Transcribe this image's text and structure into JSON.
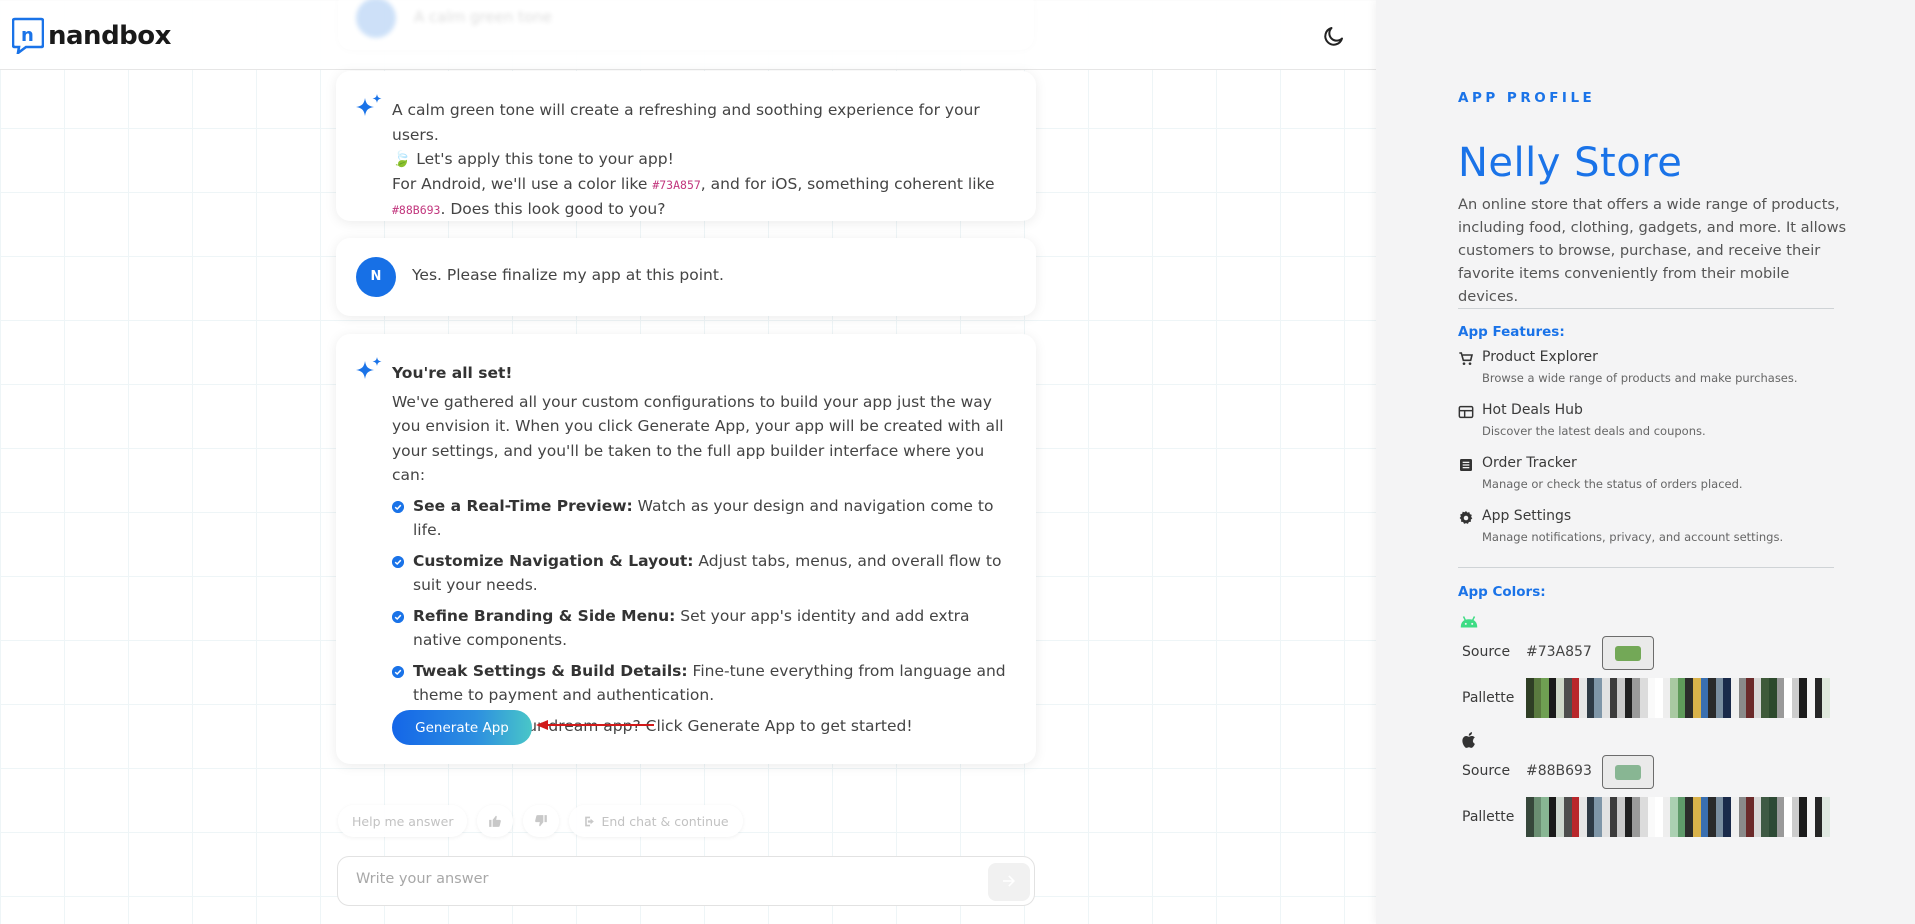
{
  "header": {
    "logo_text": "nandbox",
    "logo_mark_letter": "n",
    "theme_icon": "moon-icon"
  },
  "faded_card": {
    "text": "A calm green tone"
  },
  "assistant_message_1": {
    "line1": "A calm green tone will create a refreshing and soothing experience for your users.",
    "line2_emoji": "🍃",
    "line2": "Let's apply this tone to your app!",
    "line3_pre": "For Android, we'll use a color like ",
    "android_code": "#73A857",
    "line3_post": ", and for iOS, something coherent like",
    "ios_code": "#88B693",
    "line4_post": ". Does this look good to you?"
  },
  "user_message": {
    "avatar_letter": "N",
    "text": "Yes. Please finalize my app at this point."
  },
  "assistant_message_2": {
    "title": "You're all set!",
    "intro": "We've gathered all your custom configurations to build your app just the way you envision it. When you click Generate App, your app will be created with all your settings, and you'll be taken to the full app builder interface where you can:",
    "bullets": [
      {
        "bold": "See a Real-Time Preview:",
        "text": " Watch as your design and navigation come to life."
      },
      {
        "bold": "Customize Navigation & Layout:",
        "text": " Adjust tabs, menus, and overall flow to suit your needs."
      },
      {
        "bold": "Refine Branding & Side Menu:",
        "text": " Set your app's identity and add extra native components."
      },
      {
        "bold": "Tweak Settings & Build Details:",
        "text": " Fine-tune everything from language and theme to payment and authentication."
      }
    ],
    "outro": "Ready to build your dream app? Click Generate App to get started!",
    "button_label": "Generate App"
  },
  "chips": {
    "help_label": "Help me answer",
    "like_icon": "thumbs-up-icon",
    "dislike_icon": "thumbs-down-icon",
    "end_label": "End chat & continue"
  },
  "composer": {
    "placeholder": "Write your answer",
    "send_icon": "arrow-right-icon"
  },
  "profile": {
    "eyebrow": "APP PROFILE",
    "name": "Nelly Store",
    "description": "An online store that offers a wide range of products, including food, clothing, gadgets, and more. It allows customers to browse, purchase, and receive their favorite items conveniently from their mobile devices.",
    "features_title": "App Features:",
    "features": [
      {
        "icon": "cart-icon",
        "title": "Product Explorer",
        "desc": "Browse a wide range of products and make purchases."
      },
      {
        "icon": "deals-card-icon",
        "title": "Hot Deals Hub",
        "desc": "Discover the latest deals and coupons."
      },
      {
        "icon": "list-document-icon",
        "title": "Order Tracker",
        "desc": "Manage or check the status of orders placed."
      },
      {
        "icon": "gear-icon",
        "title": "App Settings",
        "desc": "Manage notifications, privacy, and account settings."
      }
    ],
    "colors_title": "App Colors:",
    "android": {
      "icon": "android-icon",
      "source_label": "Source",
      "source_hex": "#73A857",
      "swatch_color": "#73A857",
      "palette_label": "Pallette",
      "palette": [
        "#2f3e25",
        "#5a7a3f",
        "#6f9f52",
        "#1a1a1a",
        "#cfd8c8",
        "#4d4d4d",
        "#b8272b",
        "#e6e6e6",
        "#2e3a45",
        "#7f96a8",
        "#e2e2e2",
        "#3b3b3b",
        "#c9c9c9",
        "#1f1f1f",
        "#9a9a9a",
        "#dcdcdc",
        "#fafafa",
        "#ffffff",
        "#eeeeee",
        "#a9c9a2",
        "#5f9a5a",
        "#2b2b2b",
        "#d9b24a",
        "#3a6fb0",
        "#2a2a2a",
        "#7a8ea0",
        "#1a2a4a",
        "#f0f0f0",
        "#8a8a8a",
        "#6b2a2a",
        "#d8d8d8",
        "#3f5a3a",
        "#2d4a2d",
        "#9a9a9a",
        "#ffffff",
        "#cccccc",
        "#1c1c1c",
        "#f5f5f5",
        "#262626",
        "#dfe8dc"
      ]
    },
    "ios": {
      "icon": "apple-icon",
      "source_label": "Source",
      "source_hex": "#88B693",
      "swatch_color": "#88B693",
      "palette_label": "Pallette",
      "palette": [
        "#36473b",
        "#6a8e72",
        "#88b693",
        "#1a1a1a",
        "#cfd8d0",
        "#4d4d4d",
        "#b8272b",
        "#e6e6e6",
        "#2e3a45",
        "#7f96a8",
        "#e2e2e2",
        "#3b3b3b",
        "#c9c9c9",
        "#1f1f1f",
        "#9a9a9a",
        "#dcdcdc",
        "#fafafa",
        "#ffffff",
        "#eeeeee",
        "#abd0b2",
        "#5f9a6a",
        "#2b2b2b",
        "#d9b24a",
        "#3a6fb0",
        "#2a2a2a",
        "#7a8ea0",
        "#1a2a4a",
        "#f0f0f0",
        "#8a8a8a",
        "#6b2a2a",
        "#d8d8d8",
        "#3f5a44",
        "#2d4a35",
        "#9a9a9a",
        "#ffffff",
        "#cccccc",
        "#1c1c1c",
        "#f5f5f5",
        "#262626",
        "#dfe8e1"
      ]
    }
  },
  "colors": {
    "accent": "#1a73e8",
    "code_pink": "#c2377e",
    "arrow_red": "#d11a1a"
  }
}
